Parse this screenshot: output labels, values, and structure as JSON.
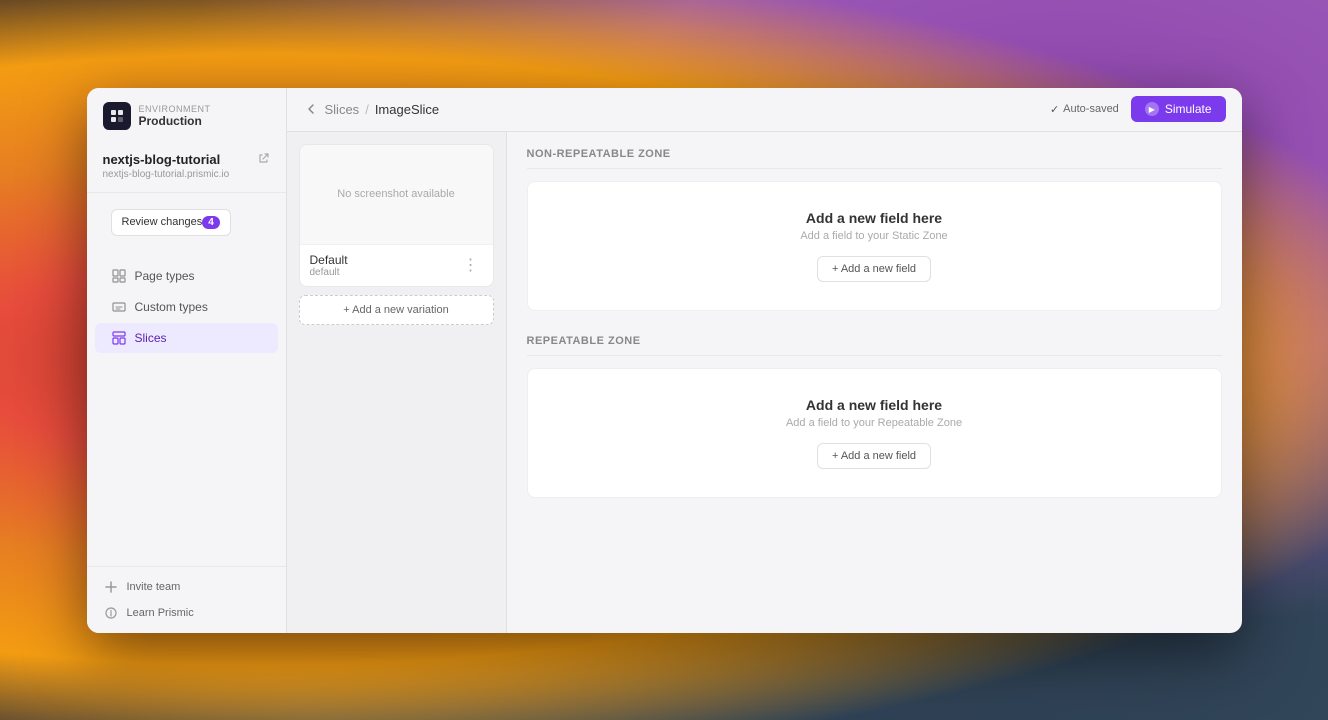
{
  "desktop": {
    "bg_description": "macOS-style colorful gradient desktop"
  },
  "window": {
    "environment": {
      "label": "Environment",
      "name": "Production"
    },
    "app_icon": "P"
  },
  "sidebar": {
    "project": {
      "name": "nextjs-blog-tutorial",
      "url": "nextjs-blog-tutorial.prismic.io"
    },
    "review_changes": {
      "label": "Review changes",
      "badge": "4"
    },
    "nav_items": [
      {
        "id": "page-types",
        "label": "Page types",
        "icon": "page-types-icon"
      },
      {
        "id": "custom-types",
        "label": "Custom types",
        "icon": "custom-types-icon"
      },
      {
        "id": "slices",
        "label": "Slices",
        "icon": "slices-icon",
        "active": true
      }
    ],
    "footer_items": [
      {
        "id": "invite-team",
        "label": "Invite team",
        "icon": "plus-icon"
      },
      {
        "id": "learn-prismic",
        "label": "Learn Prismic",
        "icon": "circle-icon"
      }
    ]
  },
  "topbar": {
    "breadcrumb": {
      "back": "←",
      "parent": "Slices",
      "separator": "/",
      "current": "ImageSlice"
    },
    "auto_saved": "Auto-saved",
    "simulate_btn": "Simulate"
  },
  "slices_panel": {
    "cards": [
      {
        "id": "default",
        "preview_text": "No screenshot available",
        "name": "Default",
        "variation": "default"
      }
    ],
    "add_variation_btn": "+ Add a new variation"
  },
  "fields_panel": {
    "non_repeatable_zone": {
      "title": "Non-Repeatable Zone",
      "empty_title": "Add a new field here",
      "empty_subtitle": "Add a field to your Static Zone",
      "add_field_btn": "+ Add a new field"
    },
    "repeatable_zone": {
      "title": "Repeatable Zone",
      "empty_title": "Add a new field here",
      "empty_subtitle": "Add a field to your Repeatable Zone",
      "add_field_btn": "+ Add a new field"
    }
  }
}
